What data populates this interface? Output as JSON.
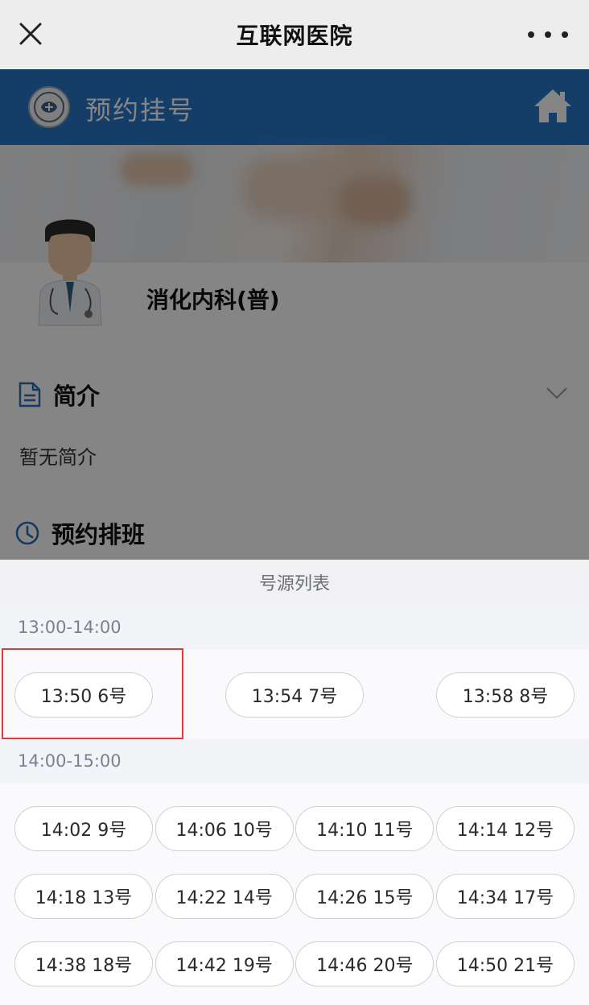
{
  "topbar": {
    "title": "互联网医院"
  },
  "header": {
    "title": "预约挂号"
  },
  "doctor": {
    "department": "消化内科(普)"
  },
  "intro": {
    "title": "简介",
    "text": "暂无简介"
  },
  "schedule": {
    "title": "预约排班"
  },
  "sheet": {
    "title": "号源列表",
    "groups": [
      {
        "label": "13:00-14:00",
        "slots": [
          "13:50 6号",
          "13:54 7号",
          "13:58 8号"
        ]
      },
      {
        "label": "14:00-15:00",
        "slots": [
          "14:02 9号",
          "14:06 10号",
          "14:10 11号",
          "14:14 12号",
          "14:18 13号",
          "14:22 14号",
          "14:26 15号",
          "14:34 17号",
          "14:38 18号",
          "14:42 19号",
          "14:46 20号",
          "14:50 21号"
        ]
      }
    ]
  },
  "colors": {
    "header_blue": "#2878c8",
    "highlight_red": "#e23b3b"
  }
}
